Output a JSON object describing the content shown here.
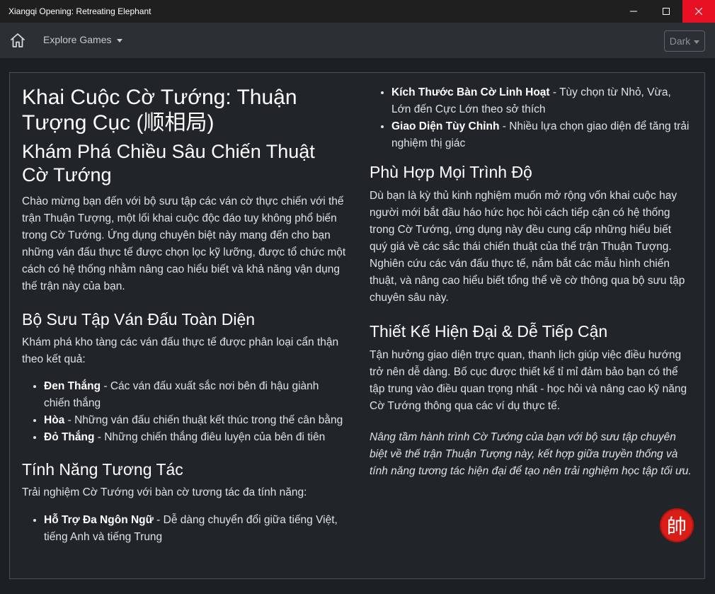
{
  "window": {
    "title": "Xiangqi Opening: Retreating Elephant"
  },
  "navbar": {
    "explore_label": "Explore Games",
    "theme_label": "Dark"
  },
  "left": {
    "title": "Khai Cuộc Cờ Tướng: Thuận Tượng Cục (顺相局)",
    "subtitle": "Khám Phá Chiều Sâu Chiến Thuật Cờ Tướng",
    "intro": "Chào mừng bạn đến với bộ sưu tập các ván cờ thực chiến với thế trận Thuận Tượng, một lối khai cuộc độc đáo tuy không phổ biến trong Cờ Tướng. Ứng dụng chuyên biệt này mang đến cho bạn những ván đấu thực tế được chọn lọc kỹ lưỡng, được tổ chức một cách có hệ thống nhằm nâng cao hiểu biết và khả năng vận dụng thế trận này của bạn.",
    "collection_heading": "Bộ Sưu Tập Ván Đấu Toàn Diện",
    "collection_text": "Khám phá kho tàng các ván đấu thực tế được phân loại cẩn thận theo kết quả:",
    "results": [
      {
        "term": "Đen Thắng",
        "desc": " - Các ván đấu xuất sắc nơi bên đi hậu giành chiến thắng"
      },
      {
        "term": "Hòa",
        "desc": " - Những ván đấu chiến thuật kết thúc trong thế cân bằng"
      },
      {
        "term": "Đỏ Thắng",
        "desc": " - Những chiến thắng điêu luyện của bên đi tiên"
      }
    ],
    "features_heading": "Tính Năng Tương Tác",
    "features_text": "Trải nghiệm Cờ Tướng với bàn cờ tương tác đa tính năng:",
    "features": [
      {
        "term": "Hỗ Trợ Đa Ngôn Ngữ",
        "desc": " - Dễ dàng chuyển đổi giữa tiếng Việt, tiếng Anh và tiếng Trung"
      }
    ]
  },
  "right": {
    "features": [
      {
        "term": "Kích Thước Bàn Cờ Linh Hoạt",
        "desc": " - Tùy chọn từ Nhỏ, Vừa, Lớn đến Cực Lớn theo sở thích"
      },
      {
        "term": "Giao Diện Tùy Chỉnh",
        "desc": " - Nhiều lựa chọn giao diện để tăng trải nghiệm thị giác"
      }
    ],
    "levels_heading": "Phù Hợp Mọi Trình Độ",
    "levels_text": "Dù bạn là kỳ thủ kinh nghiệm muốn mở rộng vốn khai cuộc hay người mới bắt đầu háo hức học hỏi cách tiếp cận có hệ thống trong Cờ Tướng, ứng dụng này đều cung cấp những hiểu biết quý giá về các sắc thái chiến thuật của thế trận Thuận Tượng. Nghiên cứu các ván đấu thực tế, nắm bắt các mẫu hình chiến thuật, và nâng cao hiểu biết tổng thể về cờ thông qua bộ sưu tập chuyên sâu này.",
    "design_heading": "Thiết Kế Hiện Đại & Dễ Tiếp Cận",
    "design_text": "Tận hưởng giao diện trực quan, thanh lịch giúp việc điều hướng trở nên dễ dàng. Bố cục được thiết kế tỉ mỉ đảm bảo bạn có thể tập trung vào điều quan trọng nhất - học hỏi và nâng cao kỹ năng Cờ Tướng thông qua các ví dụ thực tế.",
    "closing": "Nâng tầm hành trình Cờ Tướng của bạn với bộ sưu tập chuyên biệt về thế trận Thuận Tượng này, kết hợp giữa truyền thống và tính năng tương tác hiện đại để tạo nên trải nghiệm học tập tối ưu."
  },
  "logo": {
    "glyph": "帥"
  },
  "colors": {
    "close_button": "#e81123",
    "logo_red": "#d91e18"
  }
}
